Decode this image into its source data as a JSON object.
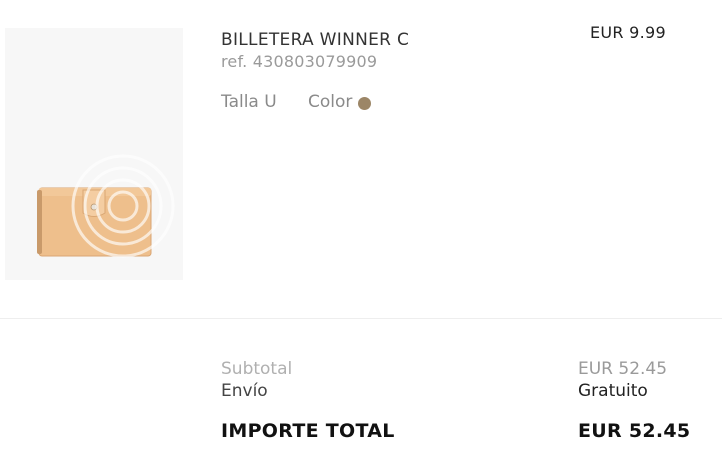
{
  "product": {
    "name": "BILLETERA WINNER C",
    "ref": "ref. 430803079909",
    "size_label": "Talla U",
    "color_label": "Color",
    "color_swatch": "#9c8667",
    "price": "EUR 9.99",
    "image_icon": "wallet-product-image"
  },
  "summary": {
    "subtotal_label": "Subtotal",
    "subtotal_value": "EUR 52.45",
    "shipping_label": "Envío",
    "shipping_value": "Gratuito",
    "total_label": "IMPORTE TOTAL",
    "total_value": "EUR 52.45"
  }
}
